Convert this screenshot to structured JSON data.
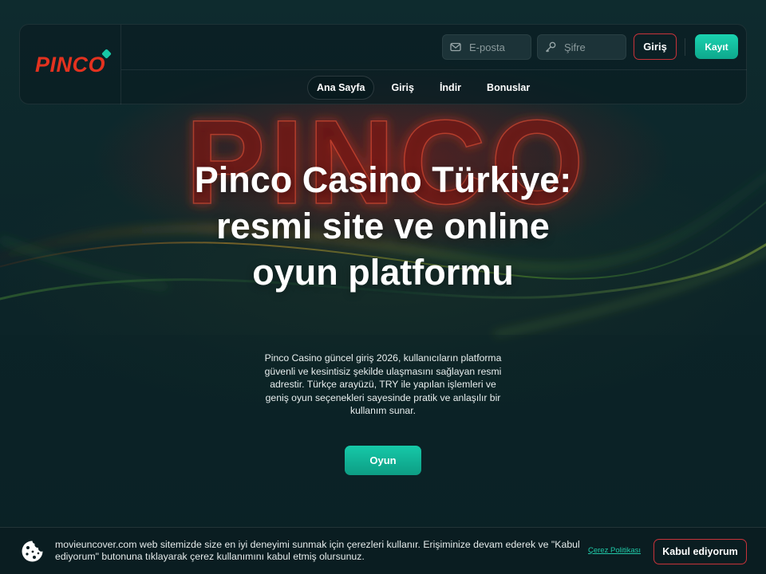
{
  "brand": {
    "logo_text": "PINCO",
    "background_text": "PINCO"
  },
  "header": {
    "email_placeholder": "E-posta",
    "password_placeholder": "Şifre",
    "login_label": "Giriş",
    "register_label": "Kayıt"
  },
  "nav": {
    "items": [
      {
        "label": "Ana Sayfa",
        "active": true
      },
      {
        "label": "Giriş"
      },
      {
        "label": "İndir"
      },
      {
        "label": "Bonuslar"
      }
    ]
  },
  "hero": {
    "title": "Pinco Casino Türkiye: resmi site ve online oyun platformu",
    "description": "Pinco Casino güncel giriş 2026, kullanıcıların platforma güvenli ve kesintisiz şekilde ulaşmasını sağlayan resmi adrestir. Türkçe arayüzü, TRY ile yapılan işlemleri ve geniş oyun seçenekleri sayesinde pratik ve anlaşılır bir kullanım sunar.",
    "cta_label": "Oyun"
  },
  "cookie": {
    "text": "movieuncover.com web sitemizde size en iyi deneyimi sunmak için çerezleri kullanır. Erişiminize devam ederek ve \"Kabul ediyorum\" butonuna tıklayarak çerez kullanımını kabul etmiş olursunuz.",
    "policy_label": "Çerez Politikası",
    "accept_label": "Kabul ediyorum"
  },
  "colors": {
    "accent": "#17c7a6",
    "brand_red": "#e3321f",
    "outline_red": "#c8333a",
    "background": "#0b2226"
  },
  "icons": {
    "email": "mail-icon",
    "password": "key-icon",
    "cookie": "cookie-icon"
  }
}
